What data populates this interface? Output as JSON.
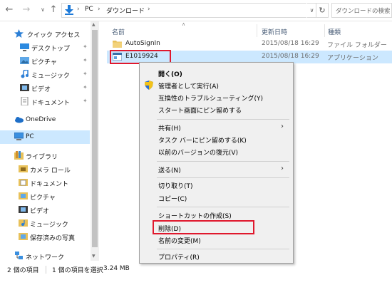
{
  "address": {
    "crumbs": [
      "PC",
      "ダウンロード"
    ],
    "search_placeholder": "ダウンロードの検索"
  },
  "sidebar": {
    "quick_access": "クイック アクセス",
    "quick_items": [
      "デスクトップ",
      "ピクチャ",
      "ミュージック",
      "ビデオ",
      "ドキュメント"
    ],
    "onedrive": "OneDrive",
    "pc": "PC",
    "libraries": "ライブラリ",
    "library_items": [
      "カメラ ロール",
      "ドキュメント",
      "ピクチャ",
      "ビデオ",
      "ミュージック",
      "保存済みの写真"
    ],
    "network": "ネットワーク"
  },
  "columns": {
    "name": "名前",
    "date": "更新日時",
    "type": "種類"
  },
  "files": [
    {
      "name": "AutoSignIn",
      "date": "2015/08/18 16:29",
      "type": "ファイル フォルダー"
    },
    {
      "name": "E1019924",
      "date": "2015/08/18 16:29",
      "type": "アプリケーション"
    }
  ],
  "status": {
    "count": "2 個の項目",
    "selected": "1 個の項目を選択",
    "size": "3.24 MB"
  },
  "context_menu": {
    "open": "開く(O)",
    "run_as_admin": "管理者として実行(A)",
    "troubleshoot": "互換性のトラブルシューティング(Y)",
    "pin_start": "スタート画面にピン留めする",
    "share": "共有(H)",
    "pin_taskbar": "タスク バーにピン留めする(K)",
    "restore_prev": "以前のバージョンの復元(V)",
    "send_to": "送る(N)",
    "cut": "切り取り(T)",
    "copy": "コピー(C)",
    "create_shortcut": "ショートカットの作成(S)",
    "delete": "削除(D)",
    "rename": "名前の変更(M)",
    "properties": "プロパティ(R)"
  },
  "colors": {
    "highlight": "#cce8ff",
    "annotation_red": "#e0182d",
    "folder": "#e8c15a",
    "accent_blue": "#1e7ad8"
  }
}
